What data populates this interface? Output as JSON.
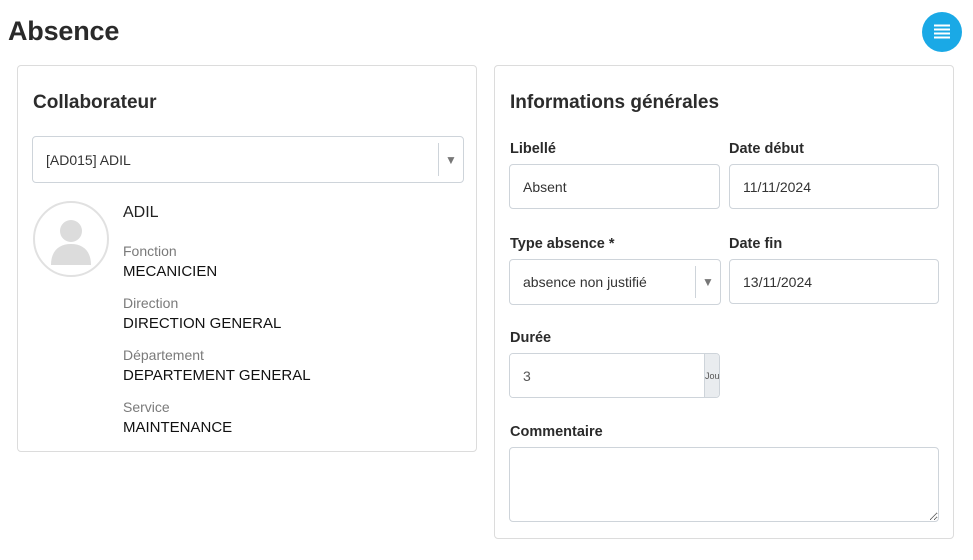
{
  "page": {
    "title": "Absence"
  },
  "header": {
    "list_icon": "list-icon",
    "accent_color": "#1aa9e6"
  },
  "collaborateur": {
    "title": "Collaborateur",
    "selected": "[AD015] ADIL",
    "avatar_icon": "user-avatar-icon",
    "name": "ADIL",
    "fields": [
      {
        "label": "Fonction",
        "value": "MECANICIEN"
      },
      {
        "label": "Direction",
        "value": "DIRECTION GENERAL"
      },
      {
        "label": "Département",
        "value": "DEPARTEMENT GENERAL"
      },
      {
        "label": "Service",
        "value": "MAINTENANCE"
      }
    ]
  },
  "informations": {
    "title": "Informations générales",
    "libelle": {
      "label": "Libellé",
      "value": "Absent"
    },
    "date_debut": {
      "label": "Date début",
      "value": "11/11/2024"
    },
    "type_absence": {
      "label": "Type absence *",
      "value": "absence non justifié"
    },
    "date_fin": {
      "label": "Date fin",
      "value": "13/11/2024"
    },
    "duree": {
      "label": "Durée",
      "value": "3",
      "unit": "Jours"
    },
    "commentaire": {
      "label": "Commentaire",
      "value": ""
    }
  }
}
